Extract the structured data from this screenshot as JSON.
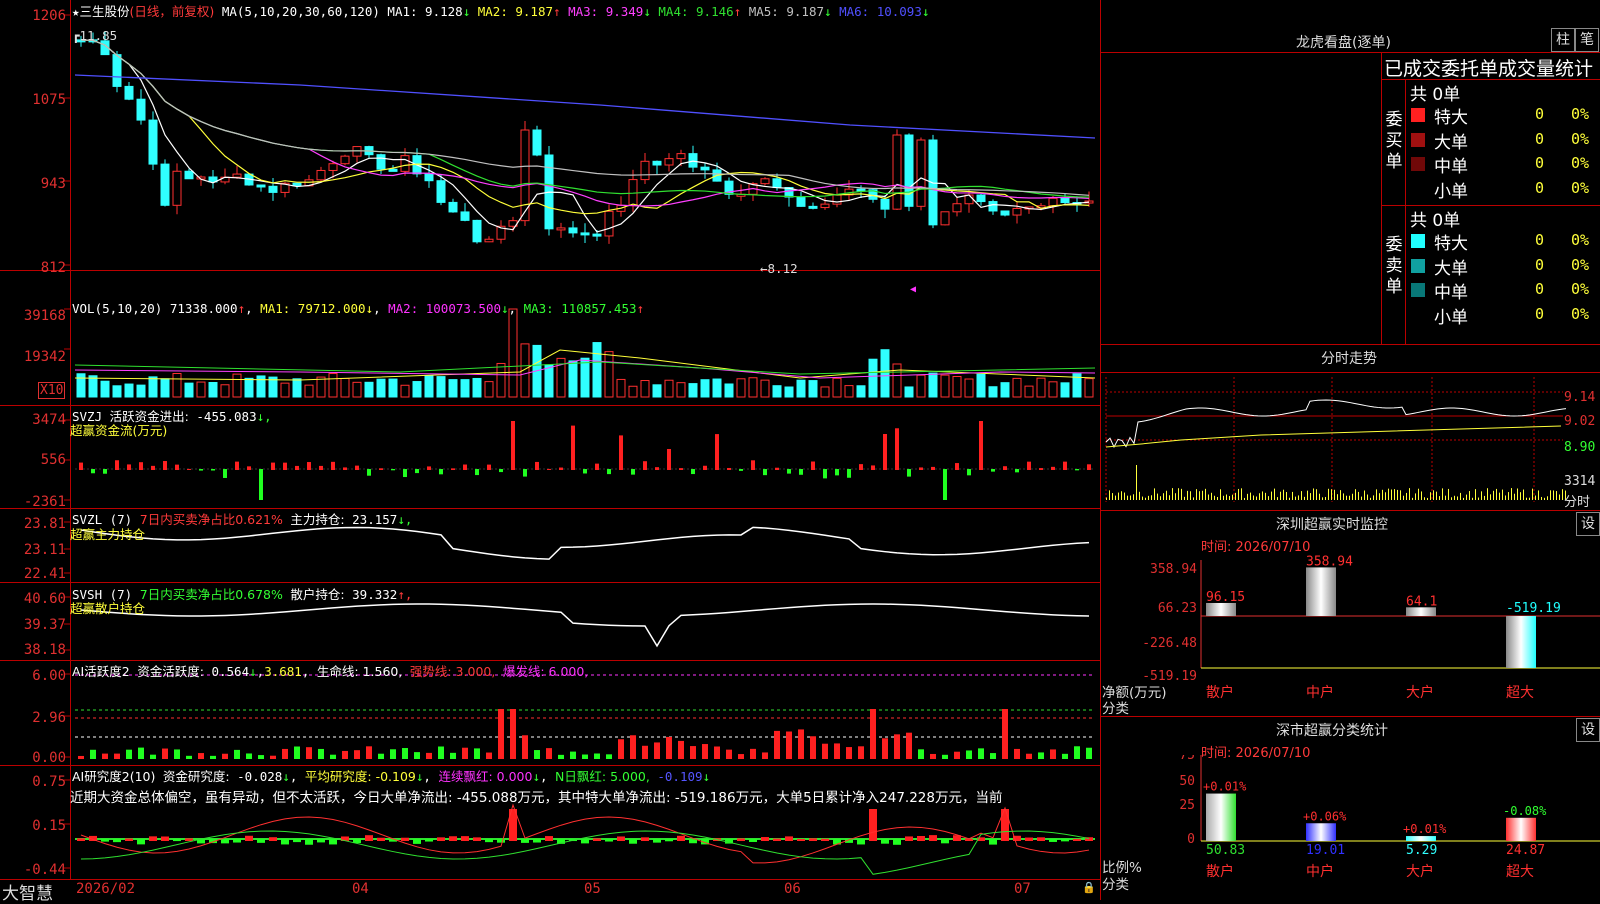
{
  "main": {
    "name": "三生股份",
    "mode": "(日线，前复权)",
    "ma_header": "MA(5,10,20,30,60,120)",
    "ma": [
      {
        "label": "MA1:",
        "value": "9.128",
        "arrow": "↓",
        "color": "#ffffff"
      },
      {
        "label": "MA2:",
        "value": "9.187",
        "arrow": "↑",
        "color": "#ffff3a"
      },
      {
        "label": "MA3:",
        "value": "9.349",
        "arrow": "↓",
        "color": "#ff40ff"
      },
      {
        "label": "MA4:",
        "value": "9.146",
        "arrow": "↑",
        "color": "#30e030"
      },
      {
        "label": "MA5:",
        "value": "9.187",
        "arrow": "↓",
        "color": "#c0c0c0"
      },
      {
        "label": "MA6:",
        "value": "10.093",
        "arrow": "↓",
        "color": "#5050ff"
      }
    ],
    "yticks": [
      "1206",
      "1075",
      "943",
      "812"
    ],
    "high_label": "11.85",
    "low_label": "←8.12"
  },
  "vol": {
    "title": "VOL(5,10,20)",
    "value": "71338.000",
    "a1": "↑",
    "ma1": "MA1: 79712.000",
    "ma2": "MA2: 100073.500",
    "ma3": "MA3: 110857.453",
    "arr": "↓",
    "arr3": "↑",
    "yticks": [
      "39168",
      "19342"
    ],
    "unit": "X10"
  },
  "svzj": {
    "title": "SVZJ",
    "label": "活跃资金进出:",
    "value": "-455.083",
    "arrow": "↓,",
    "sub": "超赢资金流(万元)",
    "yticks": [
      "3474",
      "556",
      "-2361"
    ]
  },
  "svzl": {
    "title": "SVZL (7)",
    "txt": "7日内买卖净占比0.621%",
    "label": "主力持仓:",
    "value": "23.157",
    "arrow": "↓,",
    "sub": "超赢主力持仓",
    "yticks": [
      "23.81",
      "23.11",
      "22.41"
    ]
  },
  "svsh": {
    "title": "SVSH (7)",
    "txt": "7日内买卖净占比0.678%",
    "label": "散户持仓:",
    "value": "39.332",
    "arrow": "↑,",
    "sub": "超赢散户持仓",
    "yticks": [
      "40.60",
      "39.37",
      "38.18"
    ]
  },
  "ai1": {
    "title": "AI活跃度2",
    "label": "资金活跃度:",
    "v1": "0.564",
    "v2": "3.681",
    "life": "生命线: 1.560,",
    "strong": "强势线: 3.000,",
    "burst": "爆发线: 6.000,",
    "yticks": [
      "6.00",
      "2.96",
      "0.00"
    ]
  },
  "ai2": {
    "title": "AI研究度2(10)",
    "label": "资金研究度:",
    "v1": "-0.028",
    "avg": "平均研究度: -0.109",
    "cont": "连续飘红: 0.000",
    "nday": "N日飘红: 5.000,",
    "nval": "-0.109",
    "arrow": "↓",
    "text": "近期大资金总体偏空，虽有异动，但不太活跃，今日大单净流出: -455.088万元，其中特大单净流出: -519.186万元，大单5日累计净入247.228万元，当前",
    "yticks": [
      "0.75",
      "0.15",
      "-0.44"
    ]
  },
  "xaxis": {
    "logo": "大智慧",
    "labels": [
      "2026/02",
      "04",
      "05",
      "06",
      "07"
    ]
  },
  "dragon": {
    "title": "龙虎看盘(逐单)",
    "btn1": "柱",
    "btn2": "笔",
    "header": "已成交委托单成交量统计",
    "buy": {
      "side": "委买单",
      "total": "共 0单",
      "rows": [
        {
          "name": "特大",
          "val": "0",
          "pct": "0%",
          "color": "#ff2020"
        },
        {
          "name": "大单",
          "val": "0",
          "pct": "0%",
          "color": "#a01010"
        },
        {
          "name": "中单",
          "val": "0",
          "pct": "0%",
          "color": "#700808"
        },
        {
          "name": "小单",
          "val": "0",
          "pct": "0%",
          "color": ""
        }
      ]
    },
    "sell": {
      "side": "委卖单",
      "total": "共 0单",
      "rows": [
        {
          "name": "特大",
          "val": "0",
          "pct": "0%",
          "color": "#20ffff"
        },
        {
          "name": "大单",
          "val": "0",
          "pct": "0%",
          "color": "#10a0a0"
        },
        {
          "name": "中单",
          "val": "0",
          "pct": "0%",
          "color": "#087878"
        },
        {
          "name": "小单",
          "val": "0",
          "pct": "0%",
          "color": ""
        }
      ]
    }
  },
  "intraday": {
    "title": "分时走势",
    "yticks": [
      "9.14",
      "9.02",
      "8.90"
    ],
    "vol": "3314",
    "vlabel": "分时"
  },
  "monitor": {
    "title": "深圳超赢实时监控",
    "btn": "设",
    "time": "时间: 2026/07/10",
    "ylabel": "净额(万元)",
    "xlabel": "分类",
    "yticks": [
      "358.94",
      "66.23",
      "-226.48",
      "-519.19"
    ],
    "bars": [
      {
        "cat": "散户",
        "value": 96.15,
        "label": "96.15"
      },
      {
        "cat": "中户",
        "value": 358.94,
        "label": "358.94"
      },
      {
        "cat": "大户",
        "value": 64.1,
        "label": "64.1"
      },
      {
        "cat": "超大",
        "value": -519.19,
        "label": "-519.19"
      }
    ]
  },
  "classify": {
    "title": "深市超赢分类统计",
    "btn": "设",
    "time": "时间: 2026/07/10",
    "ylabel": "比例%",
    "xlabel": "分类",
    "yticks": [
      "75",
      "50",
      "25",
      "0"
    ],
    "bars": [
      {
        "cat": "散户",
        "value": 50.83,
        "label": "50.83",
        "chg": "+0.01%",
        "color": "#30e030"
      },
      {
        "cat": "中户",
        "value": 19.01,
        "label": "19.01",
        "chg": "+0.06%",
        "color": "#3030ff"
      },
      {
        "cat": "大户",
        "value": 5.29,
        "label": "5.29",
        "chg": "+0.01%",
        "color": "#30ffff"
      },
      {
        "cat": "超大",
        "value": 24.87,
        "label": "24.87",
        "chg": "-0.08%",
        "color": "#ff3030"
      }
    ]
  },
  "chart_data": {
    "type": "table",
    "monitor_values": [
      96.15,
      358.94,
      64.1,
      -519.19
    ],
    "classify_values": [
      50.83,
      19.01,
      5.29,
      24.87
    ],
    "categories": [
      "散户",
      "中户",
      "大户",
      "超大"
    ]
  }
}
